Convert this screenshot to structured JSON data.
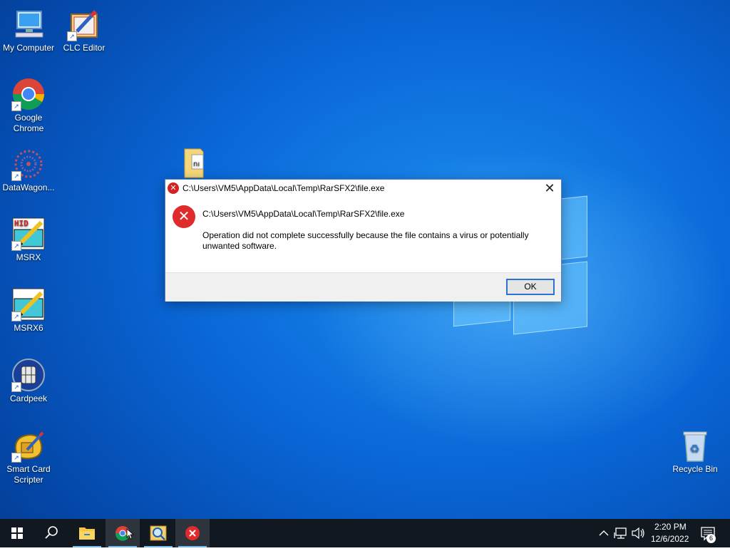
{
  "desktop": {
    "icons": [
      {
        "label": "My Computer",
        "icon": "computer-icon"
      },
      {
        "label": "CLC Editor",
        "icon": "clc-editor-icon"
      },
      {
        "label": "Google Chrome",
        "icon": "chrome-icon"
      },
      {
        "label": "DataWagon...",
        "icon": "datawagon-icon"
      },
      {
        "label": "MSRX",
        "icon": "msrx-icon"
      },
      {
        "label": "MSRX6",
        "icon": "msrx6-icon"
      },
      {
        "label": "Cardpeek",
        "icon": "cardpeek-icon"
      },
      {
        "label": "Smart Card Scripter",
        "icon": "smart-card-scripter-icon"
      },
      {
        "label": "Recycle Bin",
        "icon": "recycle-bin-icon"
      },
      {
        "label": "",
        "icon": "folder-zip-icon"
      }
    ]
  },
  "dialog": {
    "title": "C:\\Users\\VM5\\AppData\\Local\\Temp\\RarSFX2\\file.exe",
    "path": "C:\\Users\\VM5\\AppData\\Local\\Temp\\RarSFX2\\file.exe",
    "message": "Operation did not complete successfully because the file contains a virus or potentially unwanted software.",
    "ok_label": "OK",
    "close_glyph": "✕"
  },
  "taskbar": {
    "start": "start-icon",
    "search": "search-icon",
    "apps": [
      "file-explorer-icon",
      "chrome-icon",
      "magnifier-app-icon",
      "error-app-icon"
    ],
    "time": "2:20 PM",
    "date": "12/6/2022",
    "notification_count": "6"
  },
  "colors": {
    "accent": "#2a74d0",
    "error": "#e02b2b",
    "taskbar": "#111820"
  }
}
